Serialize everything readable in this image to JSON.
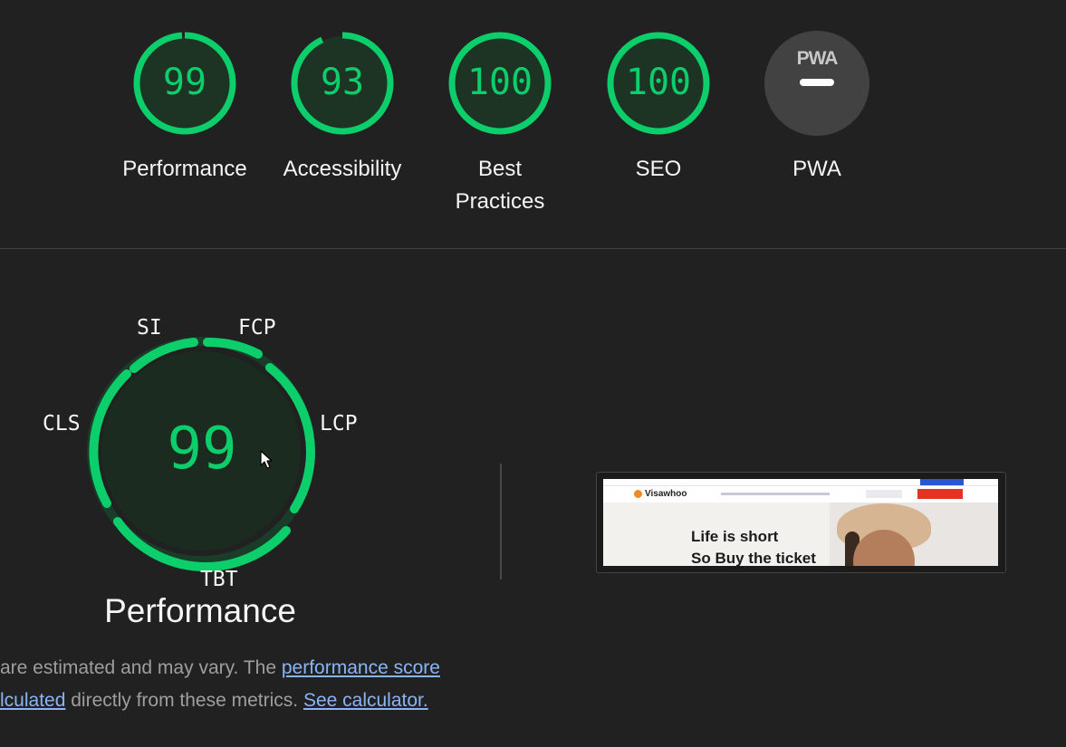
{
  "categories": [
    {
      "id": "performance",
      "score": "99",
      "label": "Performance",
      "fraction": 0.99
    },
    {
      "id": "accessibility",
      "score": "93",
      "label": "Accessibility",
      "fraction": 0.93
    },
    {
      "id": "best-practices",
      "score": "100",
      "label_line1": "Best",
      "label_line2": "Practices",
      "fraction": 1.0
    },
    {
      "id": "seo",
      "score": "100",
      "label": "SEO",
      "fraction": 1.0
    },
    {
      "id": "pwa",
      "badge_text": "PWA",
      "label": "PWA"
    }
  ],
  "performance_detail": {
    "score": "99",
    "title": "Performance",
    "metrics": {
      "si": "SI",
      "fcp": "FCP",
      "lcp": "LCP",
      "tbt": "TBT",
      "cls": "CLS"
    }
  },
  "screenshot": {
    "site_name": "Visawhoo",
    "hero_line1": "Life is short",
    "hero_line2": "So Buy the ticket"
  },
  "footnote": {
    "line1_text": " are estimated and may vary. The ",
    "line1_link": "performance score",
    "line2_link": "lculated",
    "line2_text": " directly from these metrics. ",
    "line2_link2": "See calculator."
  },
  "colors": {
    "pass": "#0cce6b",
    "pass_fill": "#1d3324",
    "background": "#212121",
    "pwa_fill": "#424242",
    "link": "#8ab4f8"
  }
}
